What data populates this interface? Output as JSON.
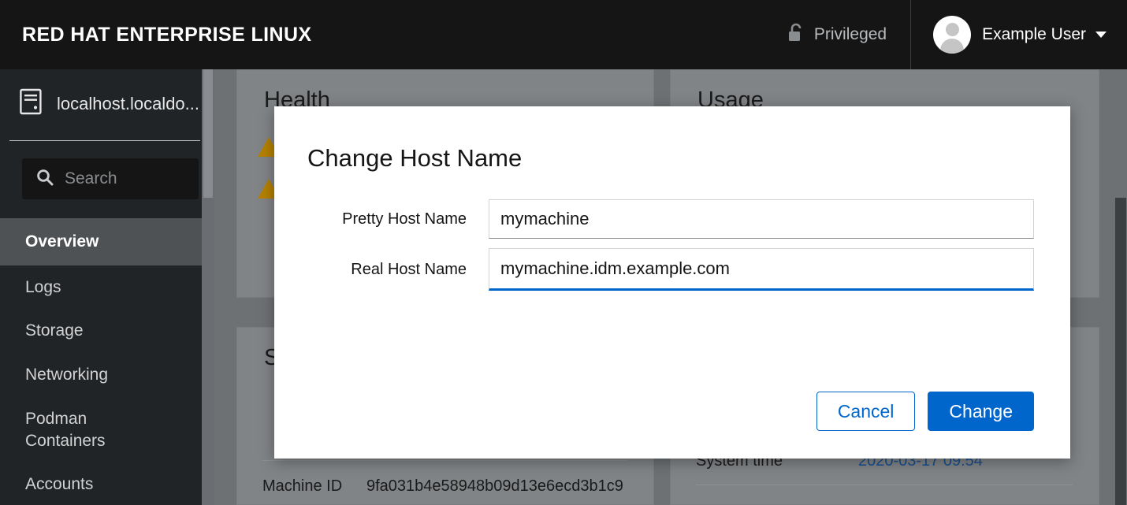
{
  "masthead": {
    "brand": "RED HAT ENTERPRISE LINUX",
    "privileged_label": "Privileged",
    "privileged_icon": "unlock-icon",
    "user_name": "Example User",
    "user_caret_icon": "caret-down-icon",
    "avatar_icon": "avatar-icon"
  },
  "sidebar": {
    "host_icon": "server-icon",
    "host_label": "localhost.localdo...",
    "search": {
      "icon": "search-icon",
      "placeholder": "Search",
      "value": ""
    },
    "items": [
      {
        "label": "Overview",
        "active": true
      },
      {
        "label": "Logs",
        "active": false
      },
      {
        "label": "Storage",
        "active": false
      },
      {
        "label": "Networking",
        "active": false
      },
      {
        "label": "Podman\nContainers",
        "active": false
      },
      {
        "label": "Accounts",
        "active": false
      }
    ]
  },
  "content": {
    "cards": {
      "health": {
        "title": "Health",
        "warning_icon": "warning-triangle-icon",
        "warning_count": 2
      },
      "usage": {
        "title": "Usage"
      },
      "system_information": {
        "title_partial": "S",
        "rows": [
          {
            "key": "Machine ID",
            "value": "9fa031b4e58948b09d13e6ecd3b1c9"
          }
        ]
      },
      "configuration": {
        "rows": [
          {
            "key": "System time",
            "value": "2020-03-17 09:54",
            "is_link": true
          }
        ]
      }
    }
  },
  "modal": {
    "title": "Change Host Name",
    "fields": [
      {
        "label": "Pretty Host Name",
        "value": "mymachine",
        "placeholder": "",
        "focused": false
      },
      {
        "label": "Real Host Name",
        "value": "mymachine.idm.example.com",
        "placeholder": "",
        "focused": true
      }
    ],
    "cancel_label": "Cancel",
    "confirm_label": "Change"
  },
  "colors": {
    "masthead_bg": "#151515",
    "sidebar_bg": "#212427",
    "sidebar_active_bg": "#4f5255",
    "primary_blue": "#0066cc",
    "link_blue": "#19508f",
    "warning_amber": "#b58100",
    "dim_overlay": "#6e7174"
  }
}
